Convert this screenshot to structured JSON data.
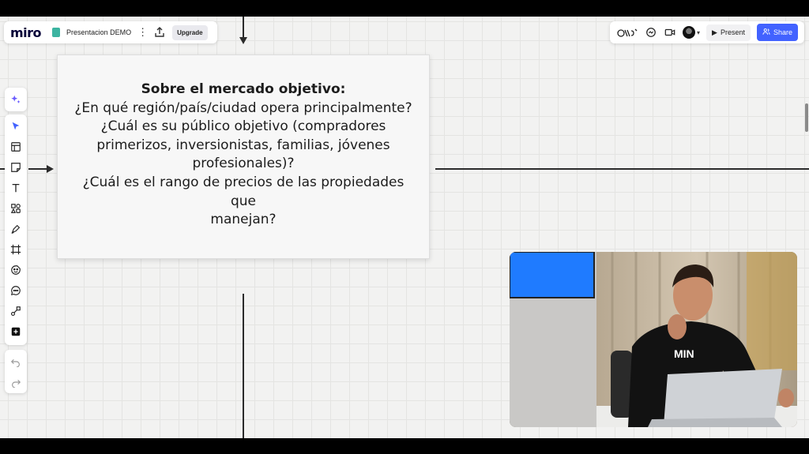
{
  "app": {
    "logo": "miro",
    "board_name": "Presentacion DEMO",
    "upgrade_label": "Upgrade",
    "present_label": "Present",
    "share_label": "Share",
    "accent_color": "#4262ff"
  },
  "card": {
    "title": "Sobre el mercado objetivo:",
    "lines": [
      "¿En qué región/país/ciudad opera principalmente?",
      "¿Cuál es su público objetivo (compradores",
      "primerizos, inversionistas, familias, jóvenes",
      "profesionales)?",
      "¿Cuál es el rango de precios de las propiedades que",
      "manejan?"
    ]
  },
  "toolbar": {
    "tools": [
      "ai-sparkle-icon",
      "select-cursor-icon",
      "templates-icon",
      "sticky-note-icon",
      "text-icon",
      "shapes-icon",
      "pen-icon",
      "frame-icon",
      "sticker-icon",
      "comment-icon",
      "connection-line-icon",
      "more-apps-icon"
    ],
    "history": [
      "undo-icon",
      "redo-icon"
    ]
  },
  "top_right_icons": [
    "reactions-icon",
    "chat-icon",
    "video-icon",
    "avatar",
    "present-icon",
    "share-icon"
  ],
  "webcam": {
    "shirt_text": "MIN"
  }
}
